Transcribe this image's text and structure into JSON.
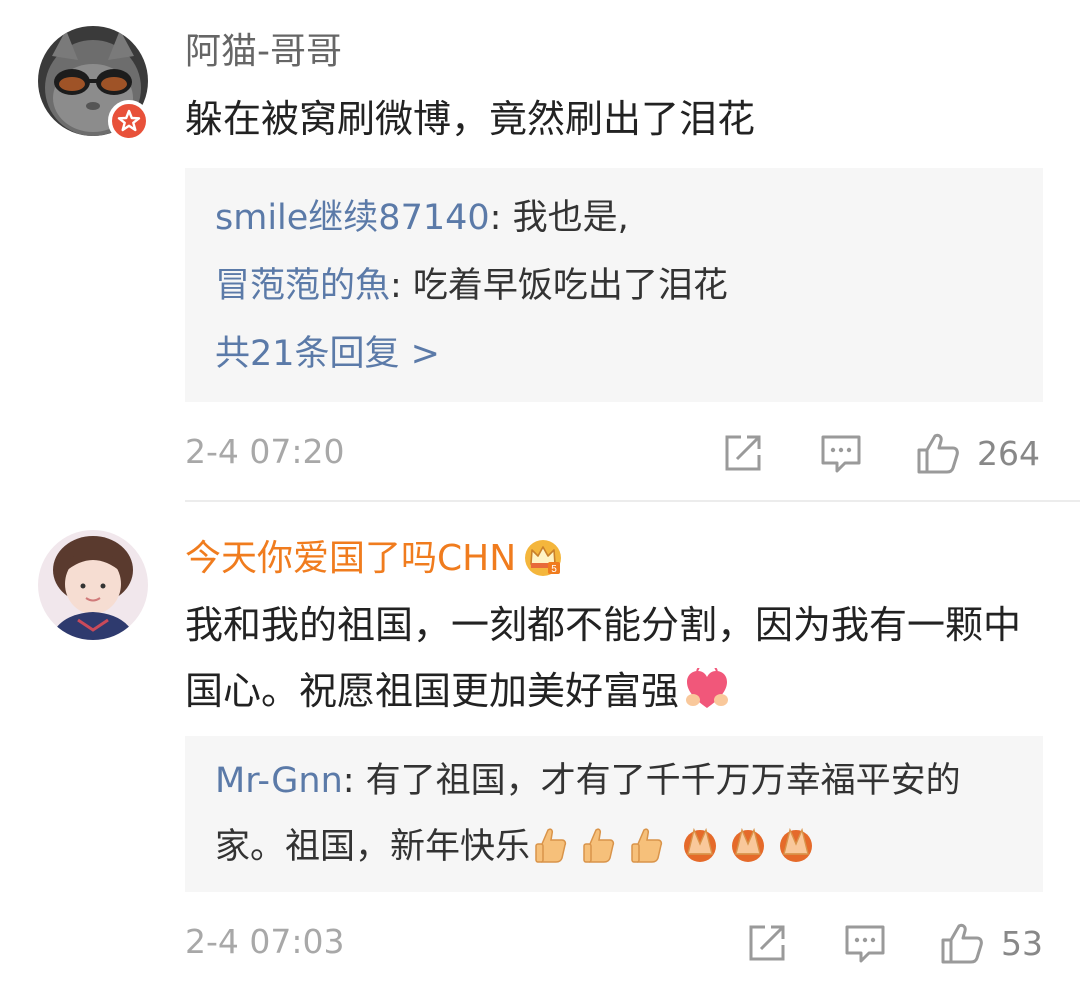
{
  "comments": [
    {
      "username": "阿猫-哥哥",
      "text": "躲在被窝刷微博，竟然刷出了泪花",
      "replies": [
        {
          "author": "smile继续87140",
          "text": ": 我也是,"
        },
        {
          "author": "冒萢萢的魚",
          "text": ": 吃着早饭吃出了泪花"
        }
      ],
      "more_replies": "共21条回复 >",
      "timestamp": "2-4 07:20",
      "likes": "264",
      "avatar_icon": "cat-with-sunglasses-avatar",
      "badge_icon": "verified-star-badge-icon"
    },
    {
      "username": "今天你爱国了吗CHN",
      "username_color": "#f07c1e",
      "name_icon": "crown-icon",
      "text": "我和我的祖国，一刻都不能分割，因为我有一颗中国心。祝愿祖国更加美好富强",
      "text_emoji": "heart-hands-emoji",
      "replies": [
        {
          "author": "Mr-Gnn",
          "text": ": 有了祖国，才有了千千万万幸福平安的家。祖国，新年快乐"
        }
      ],
      "reply_emojis": [
        "thumbs-up-emoji",
        "thumbs-up-emoji",
        "thumbs-up-emoji",
        "praying-hands-emoji",
        "praying-hands-emoji",
        "praying-hands-emoji"
      ],
      "timestamp": "2-4 07:03",
      "likes": "53",
      "avatar_icon": "girl-avatar"
    }
  ],
  "actions": {
    "repost_icon": "repost-icon",
    "comment_icon": "comment-icon",
    "like_icon": "like-thumb-icon"
  },
  "colors": {
    "link": "#5b7aa8",
    "vip_name": "#f07c1e",
    "reply_bg": "#f6f6f6",
    "meta": "#a8a8a8"
  }
}
